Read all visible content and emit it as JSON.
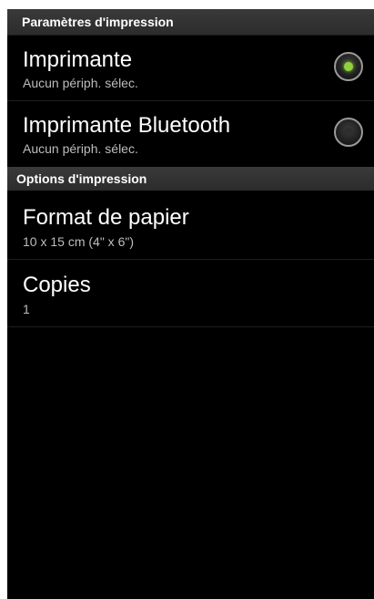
{
  "section_printing": {
    "header": "Paramètres d'impression",
    "items": [
      {
        "title": "Imprimante",
        "subtitle": "Aucun périph. sélec.",
        "checked": true
      },
      {
        "title": "Imprimante Bluetooth",
        "subtitle": "Aucun périph. sélec.",
        "checked": false
      }
    ]
  },
  "section_options": {
    "header": "Options d'impression",
    "items": [
      {
        "title": "Format de papier",
        "subtitle": "10 x 15 cm (4\" x 6\")"
      },
      {
        "title": "Copies",
        "subtitle": "1"
      }
    ]
  },
  "colors": {
    "background": "#000000",
    "header_bg": "#333333",
    "accent_green": "#8fd33a",
    "subtitle_gray": "#bdbdbd"
  }
}
